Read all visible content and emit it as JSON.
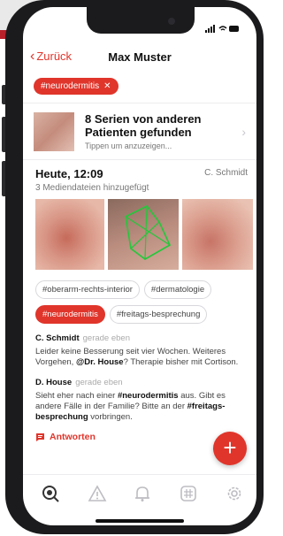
{
  "nav": {
    "back_label": "Zurück",
    "title": "Max Muster"
  },
  "filter_chip": {
    "label": "#neurodermitis"
  },
  "series": {
    "title": "8 Serien von anderen Patienten gefunden",
    "subtitle": "Tippen um anzuzeigen..."
  },
  "post": {
    "date": "Heute, 12:09",
    "author": "C. Schmidt",
    "subtitle": "3 Mediendateien hinzugefügt",
    "tags": [
      "#oberarm-rechts-interior",
      "#dermatologie",
      "#neurodermitis",
      "#freitags-besprechung"
    ]
  },
  "comments": [
    {
      "name": "C. Schmidt",
      "time": "gerade eben",
      "text_before": "Leider keine Besserung seit vier Wochen. Weiteres Vorgehen, ",
      "bold": "@Dr. House",
      "text_after": "? Therapie bisher mit Cortison."
    },
    {
      "name": "D. House",
      "time": "gerade eben",
      "text_before": "Sieht eher nach einer ",
      "bold": "#neurodermitis",
      "text_middle": " aus. Gibt es andere Fälle in der Familie? Bitte an der ",
      "bold2": "#freitags-besprechung",
      "text_after": " vorbringen."
    }
  ],
  "reply_label": "Antworten",
  "fab_label": "+",
  "tabbar": [
    "search-icon",
    "warning-icon",
    "bell-icon",
    "hashtag-icon",
    "gear-icon"
  ],
  "colors": {
    "accent": "#e0352b",
    "active_tab": "#333333",
    "inactive_tab": "#bdbdc2"
  }
}
